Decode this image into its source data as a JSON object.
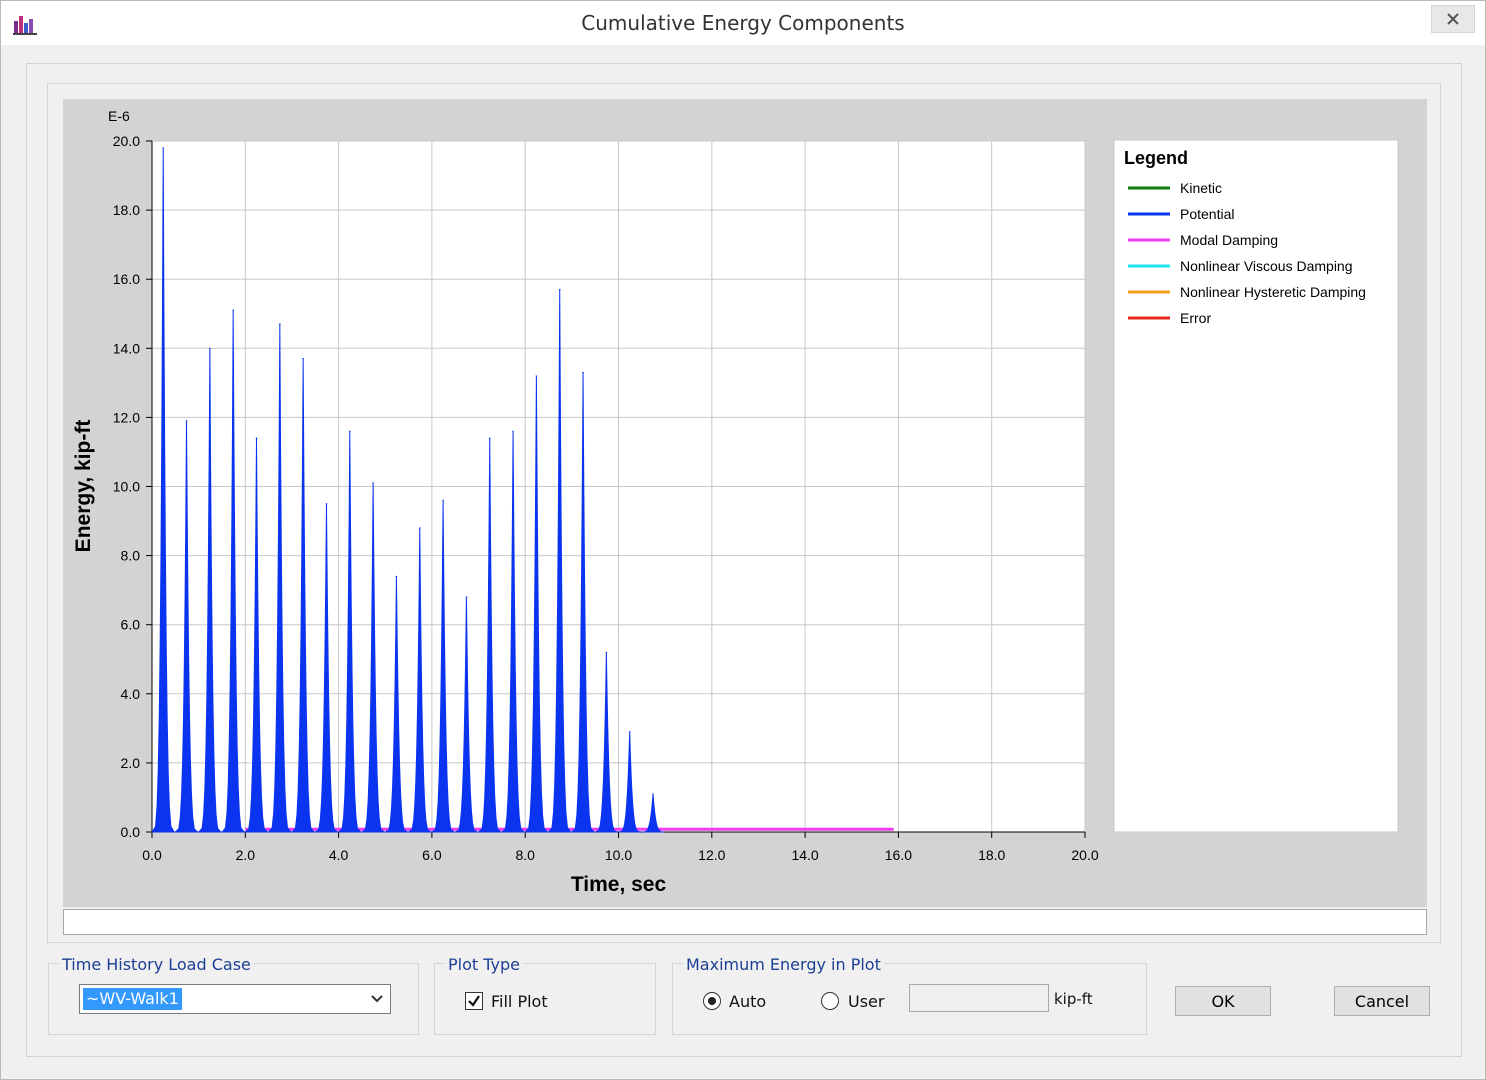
{
  "window": {
    "title": "Cumulative Energy Components",
    "close_label": "×"
  },
  "chart_data": {
    "type": "area",
    "xlabel": "Time, sec",
    "ylabel": "Energy, kip-ft",
    "y_exponent_label": "E-6",
    "xlim": [
      0,
      20
    ],
    "ylim": [
      0,
      20
    ],
    "x_ticks": [
      "0.0",
      "2.0",
      "4.0",
      "6.0",
      "8.0",
      "10.0",
      "12.0",
      "14.0",
      "16.0",
      "18.0",
      "20.0"
    ],
    "y_ticks": [
      "0.0",
      "2.0",
      "4.0",
      "6.0",
      "8.0",
      "10.0",
      "12.0",
      "14.0",
      "16.0",
      "18.0",
      "20.0"
    ],
    "grid": true,
    "fill": true,
    "legend_title": "Legend",
    "legend_placement": "right",
    "series": [
      {
        "name": "Kinetic",
        "color": "#0a7d0a",
        "values": []
      },
      {
        "name": "Potential",
        "color": "#0a34f0",
        "peaks": [
          {
            "x": 0.24,
            "y": 19.8
          },
          {
            "x": 0.74,
            "y": 11.9
          },
          {
            "x": 1.24,
            "y": 14.0
          },
          {
            "x": 1.74,
            "y": 15.1
          },
          {
            "x": 2.24,
            "y": 11.4
          },
          {
            "x": 2.74,
            "y": 14.7
          },
          {
            "x": 3.24,
            "y": 13.7
          },
          {
            "x": 3.74,
            "y": 9.5
          },
          {
            "x": 4.24,
            "y": 11.6
          },
          {
            "x": 4.74,
            "y": 10.1
          },
          {
            "x": 5.24,
            "y": 7.4
          },
          {
            "x": 5.74,
            "y": 8.8
          },
          {
            "x": 6.24,
            "y": 9.6
          },
          {
            "x": 6.74,
            "y": 6.8
          },
          {
            "x": 7.24,
            "y": 11.4
          },
          {
            "x": 7.74,
            "y": 11.6
          },
          {
            "x": 8.24,
            "y": 13.2
          },
          {
            "x": 8.74,
            "y": 15.7
          },
          {
            "x": 9.24,
            "y": 13.3
          },
          {
            "x": 9.74,
            "y": 5.2
          },
          {
            "x": 10.24,
            "y": 2.9
          },
          {
            "x": 10.74,
            "y": 1.1
          }
        ]
      },
      {
        "name": "Modal Damping",
        "color": "#f03cf0",
        "x": [
          2.0,
          15.9
        ],
        "y": [
          0.05,
          0.05
        ]
      },
      {
        "name": "Nonlinear Viscous Damping",
        "color": "#1ee6f0",
        "values": []
      },
      {
        "name": "Nonlinear Hysteretic Damping",
        "color": "#f0a01e",
        "values": []
      },
      {
        "name": "Error",
        "color": "#e82a1e",
        "values": []
      }
    ]
  },
  "load_case": {
    "label": "Time History Load Case",
    "value": "~WV-Walk1"
  },
  "plot_type": {
    "label": "Plot Type",
    "fill_plot_label": "Fill Plot",
    "fill_plot_checked": true
  },
  "max_energy": {
    "label": "Maximum Energy in Plot",
    "auto_label": "Auto",
    "user_label": "User",
    "selected": "Auto",
    "value": "",
    "unit": "kip-ft"
  },
  "buttons": {
    "ok": "OK",
    "cancel": "Cancel"
  }
}
